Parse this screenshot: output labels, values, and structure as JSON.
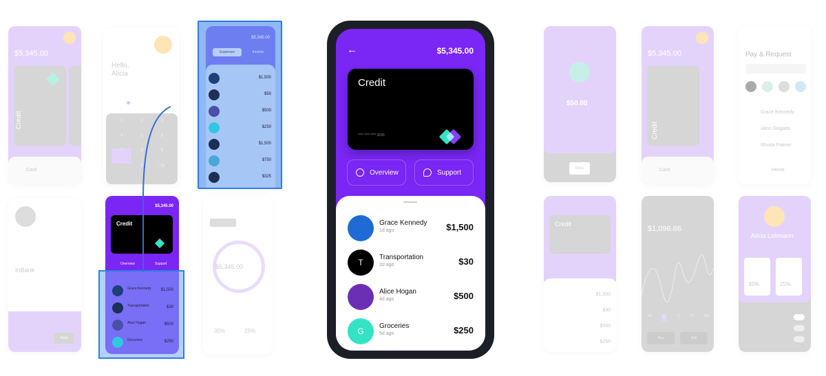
{
  "colors": {
    "primary": "#7a26f5",
    "accent": "#34e3c3",
    "highlight": "#2f7de1"
  },
  "main": {
    "balance": "$5,345.00",
    "back_icon": "arrow-left-icon",
    "card": {
      "title": "Credit",
      "number": "**** **** **** 3290"
    },
    "buttons": [
      {
        "label": "Overview",
        "icon": "pie-chart-icon"
      },
      {
        "label": "Support",
        "icon": "chat-icon"
      }
    ],
    "transactions": [
      {
        "name": "Grace Kennedy",
        "time": "1d ago",
        "amount": "$1,500",
        "initial": "",
        "color": "#1e6bd6"
      },
      {
        "name": "Transportation",
        "time": "2d ago",
        "amount": "$30",
        "initial": "T",
        "color": "#000000"
      },
      {
        "name": "Alice Hogan",
        "time": "4d ago",
        "amount": "$500",
        "initial": "",
        "color": "#6a2fb5"
      },
      {
        "name": "Groceries",
        "time": "5d ago",
        "amount": "$250",
        "initial": "G",
        "color": "#34e3c3"
      }
    ]
  },
  "screens": {
    "wallet": {
      "balance": "$5,345.00",
      "card": "Credit",
      "nav": "Card"
    },
    "hello": {
      "greeting": "Hello,",
      "name": "Alicia",
      "keys": [
        "1",
        "2",
        "3",
        "4",
        "5",
        "6",
        "7",
        "8",
        "9",
        "",
        "0",
        "⌫"
      ]
    },
    "list": {
      "balance": "$5,345.00",
      "tabs": [
        "Expenses",
        "Income"
      ],
      "amounts": [
        "$1,500",
        "$50",
        "$500",
        "$250",
        "$1,500",
        "$750",
        "$325"
      ]
    },
    "inbank": {
      "title": "InBank",
      "button": "Next"
    },
    "small_credit": {
      "balance": "$5,345.00",
      "card": "Credit",
      "buttons": [
        "Overview",
        "Support"
      ],
      "rows": [
        {
          "name": "Grace Kennedy",
          "amount": "$1,500"
        },
        {
          "name": "Transportation",
          "amount": "$30"
        },
        {
          "name": "Alice Hogan",
          "amount": "$500"
        },
        {
          "name": "Groceries",
          "amount": "$250"
        }
      ]
    },
    "overview": {
      "total": "$5,345.00",
      "stats": [
        "35%",
        "25%"
      ]
    },
    "sent": {
      "amount": "$50.00",
      "button": "Done"
    },
    "wallet2": {
      "balance": "$5,345.00",
      "card": "Credit",
      "nav": "Card"
    },
    "pay": {
      "title": "Pay & Request",
      "contacts": [
        "Grace Kennedy",
        "Alice Delgado",
        "Rhoda Palmer"
      ],
      "nav": "Home"
    },
    "credit_faded": {
      "card": "Credit",
      "amounts": [
        "$1,500",
        "$30",
        "$500",
        "$250"
      ]
    },
    "stock": {
      "value": "$1,096.66",
      "buttons": [
        "Buy",
        "Sell"
      ],
      "periods": [
        "M",
        "W",
        "D",
        "1H",
        "ALL"
      ]
    },
    "profile": {
      "name": "Alicia Lohmann",
      "stats": [
        "35%",
        "25%"
      ]
    }
  }
}
